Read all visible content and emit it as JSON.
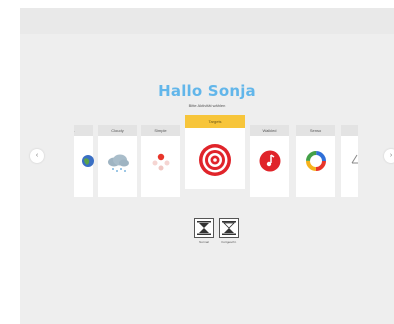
{
  "header": {
    "greeting": "Hallo Sonja",
    "subtitle": "Bitte Aktivität wählen"
  },
  "carousel": {
    "prev_icon": "chevron-left-icon",
    "next_icon": "chevron-right-icon",
    "cards": [
      {
        "label": "...",
        "icon": "globe-icon"
      },
      {
        "label": "Cloudy",
        "icon": "cloud-rain-icon"
      },
      {
        "label": "Simple",
        "icon": "dots-icon"
      },
      {
        "label": "Targets",
        "icon": "target-icon",
        "active": true
      },
      {
        "label": "Walkled",
        "icon": "music-note-icon"
      },
      {
        "label": "Senso",
        "icon": "color-ring-icon"
      },
      {
        "label": "...",
        "icon": "line-icon"
      }
    ]
  },
  "modes": [
    {
      "label": "Normal",
      "icon": "hourglass-icon"
    },
    {
      "label": "Fortgeschr.",
      "icon": "hourglass-half-icon"
    }
  ],
  "colors": {
    "title": "#62b6ea",
    "active_tab": "#f7c53a",
    "target_red": "#e0242a",
    "music_red": "#e0242a"
  }
}
